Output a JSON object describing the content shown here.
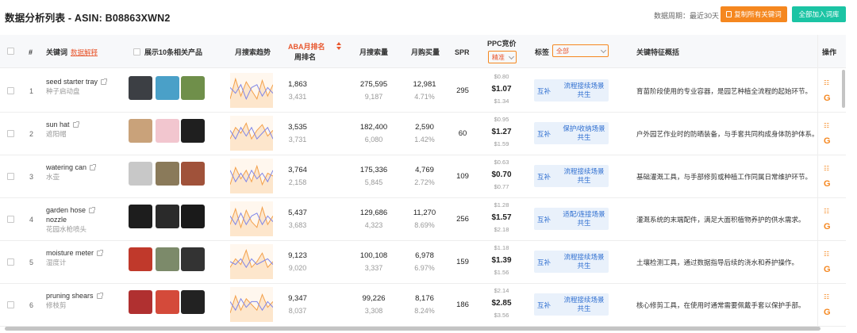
{
  "header": {
    "title": "数据分析列表 - ASIN: B08863XWN2",
    "period": "数据周期：最近30天",
    "copy_button": "复制所有关键词",
    "add_button": "全部加入词库"
  },
  "columns": {
    "index": "#",
    "keyword": "关键词",
    "keyword_link": "数据解释",
    "products": "展示10条相关产品",
    "trend": "月搜索趋势",
    "aba_line1": "ABA月排名",
    "aba_line2": "周排名",
    "monthly_search": "月搜索量",
    "monthly_buy": "月购买量",
    "spr": "SPR",
    "ppc": "PPC竞价",
    "ppc_select": "精准",
    "tags": "标签",
    "tag_select": "全部",
    "features": "关键特征概括",
    "actions": "操作"
  },
  "rows": [
    {
      "idx": "1",
      "kw": "seed starter tray",
      "kw2": "",
      "cn": "种子启动盘",
      "aba": "1,863",
      "week": "3,431",
      "search": "275,595",
      "search2": "9,187",
      "buy": "12,981",
      "rate": "4.71%",
      "spr": "295",
      "ppc_hi": "$0.80",
      "ppc": "$1.07",
      "ppc_lo": "$1.34",
      "tagA": "互补",
      "tagB": "流程接续场景共生",
      "desc": "育苗阶段使用的专业容器，是园艺种植全流程的起始环节。",
      "trend": [
        0.2,
        0.9,
        0.3,
        0.8,
        0.5,
        0.2,
        0.85,
        0.3,
        0.7
      ],
      "trend2": [
        0.6,
        0.4,
        0.7,
        0.2,
        0.6,
        0.7,
        0.3,
        0.6,
        0.4
      ]
    },
    {
      "idx": "2",
      "kw": "sun hat",
      "kw2": "",
      "cn": "遮阳帽",
      "aba": "3,535",
      "week": "3,731",
      "search": "182,400",
      "search2": "6,080",
      "buy": "2,590",
      "rate": "1.42%",
      "spr": "60",
      "ppc_hi": "$0.95",
      "ppc": "$1.27",
      "ppc_lo": "$1.59",
      "tagA": "互补",
      "tagB": "保护/收纳场景共生",
      "desc": "户外园艺作业时的防晒装备，与手套共同构成身体防护体系。",
      "trend": [
        0.3,
        0.7,
        0.5,
        0.85,
        0.3,
        0.6,
        0.8,
        0.4,
        0.6
      ],
      "trend2": [
        0.6,
        0.3,
        0.7,
        0.4,
        0.7,
        0.3,
        0.5,
        0.7,
        0.3
      ]
    },
    {
      "idx": "3",
      "kw": "watering can",
      "kw2": "",
      "cn": "水壶",
      "aba": "3,764",
      "week": "2,158",
      "search": "175,336",
      "search2": "5,845",
      "buy": "4,769",
      "rate": "2.72%",
      "spr": "109",
      "ppc_hi": "$0.63",
      "ppc": "$0.70",
      "ppc_lo": "$0.77",
      "tagA": "互补",
      "tagB": "流程接续场景共生",
      "desc": "基础灌溉工具，与手部修剪或种植工作同属日常维护环节。",
      "trend": [
        0.2,
        0.8,
        0.4,
        0.7,
        0.3,
        0.85,
        0.2,
        0.6,
        0.5
      ],
      "trend2": [
        0.7,
        0.3,
        0.6,
        0.3,
        0.7,
        0.4,
        0.6,
        0.3,
        0.7
      ]
    },
    {
      "idx": "4",
      "kw": "garden hose",
      "kw2": "nozzle",
      "cn": "花园水枪喷头",
      "aba": "5,437",
      "week": "3,683",
      "search": "129,686",
      "search2": "4,323",
      "buy": "11,270",
      "rate": "8.69%",
      "spr": "256",
      "ppc_hi": "$1.28",
      "ppc": "$1.57",
      "ppc_lo": "$2.18",
      "tagA": "互补",
      "tagB": "适配/连接场景共生",
      "desc": "灌溉系统的末端配件，满足大面积植物养护的供水需求。",
      "trend": [
        0.3,
        0.85,
        0.2,
        0.8,
        0.4,
        0.2,
        0.9,
        0.3,
        0.6
      ],
      "trend2": [
        0.6,
        0.3,
        0.7,
        0.3,
        0.6,
        0.7,
        0.3,
        0.6,
        0.4
      ]
    },
    {
      "idx": "5",
      "kw": "moisture meter",
      "kw2": "",
      "cn": "湿度计",
      "aba": "9,123",
      "week": "9,020",
      "search": "100,108",
      "search2": "3,337",
      "buy": "6,978",
      "rate": "6.97%",
      "spr": "159",
      "ppc_hi": "$1.18",
      "ppc": "$1.39",
      "ppc_lo": "$1.56",
      "tagA": "互补",
      "tagB": "流程接续场景共生",
      "desc": "土壤检测工具，通过数据指导后续的浇水和养护操作。",
      "trend": [
        0.3,
        0.6,
        0.4,
        0.9,
        0.3,
        0.5,
        0.8,
        0.3,
        0.5
      ],
      "trend2": [
        0.5,
        0.4,
        0.6,
        0.3,
        0.6,
        0.4,
        0.5,
        0.6,
        0.4
      ]
    },
    {
      "idx": "6",
      "kw": "pruning shears",
      "kw2": "",
      "cn": "修枝剪",
      "aba": "9,347",
      "week": "8,037",
      "search": "99,226",
      "search2": "3,308",
      "buy": "8,176",
      "rate": "8.24%",
      "spr": "186",
      "ppc_hi": "$2.14",
      "ppc": "$2.85",
      "ppc_lo": "$3.56",
      "tagA": "互补",
      "tagB": "流程接续场景共生",
      "desc": "核心修剪工具，在使用时通常需要佩戴手套以保护手部。",
      "trend": [
        0.2,
        0.8,
        0.3,
        0.7,
        0.5,
        0.3,
        0.85,
        0.4,
        0.6
      ],
      "trend2": [
        0.6,
        0.3,
        0.7,
        0.4,
        0.6,
        0.6,
        0.3,
        0.6,
        0.4
      ]
    }
  ],
  "colors": {
    "accent": "#f5871f",
    "teal": "#1bc4a4",
    "tag_bg": "#e9f1fb",
    "tag_text": "#2f6fd0",
    "trend_orange": "#f3a04a",
    "trend_blue": "#7f86e8"
  },
  "icons": {
    "link": "external-link-icon",
    "analyze": "analyze-icon",
    "google": "google-icon",
    "copy": "copy-icon",
    "sort": "sort-icon"
  },
  "google_glyph": "G",
  "analyze_glyph": "☷"
}
